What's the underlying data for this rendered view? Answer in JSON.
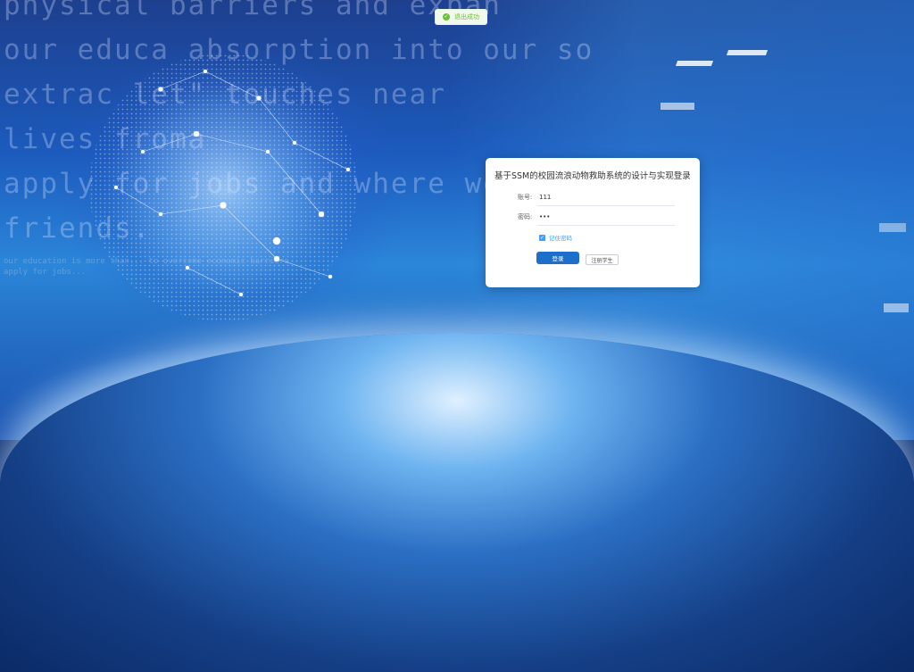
{
  "background": {
    "lines": [
      "physical barriers and expan",
      "our educa   absorption into our so",
      "extrac       let\" touches near",
      "lives froma",
      "apply for jobs and where we",
      "friends."
    ],
    "small_lines": [
      "our education is more than... to overcome economic barriers",
      "apply for jobs..."
    ]
  },
  "toast": {
    "text": "退出成功",
    "color": "#67c23a"
  },
  "login": {
    "title": "基于SSM的校园流浪动物救助系统的设计与实现登录",
    "account_label": "账号:",
    "account_value": "111",
    "password_label": "密码:",
    "password_value": "111",
    "remember_label": "记住密码",
    "remember_checked": true,
    "login_button": "登录",
    "register_button": "注册学生",
    "accent_color": "#1e6fc9"
  }
}
